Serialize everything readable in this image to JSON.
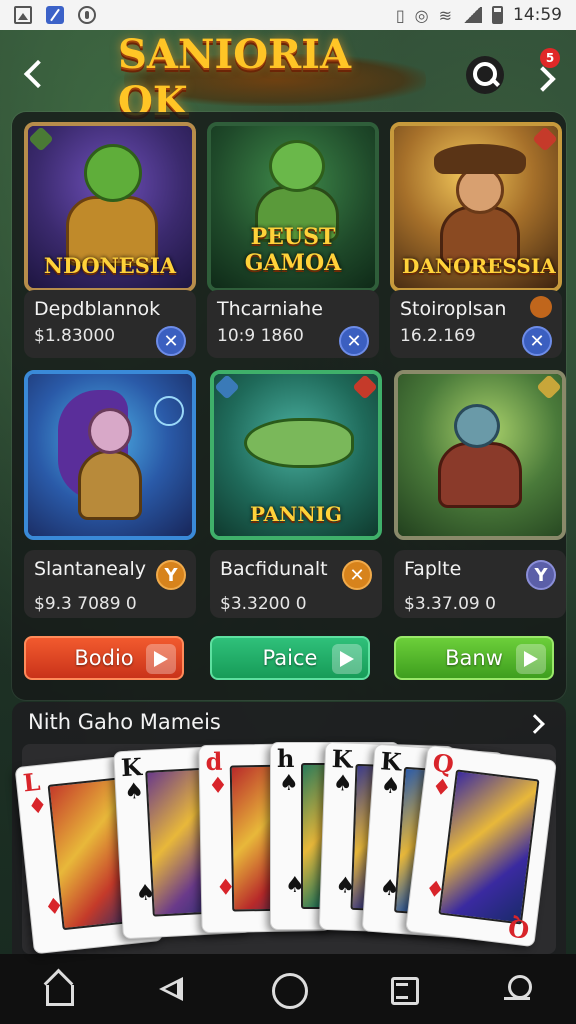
{
  "status_bar": {
    "time": "14:59",
    "icons": [
      "image-icon",
      "app-icon",
      "sync-icon",
      "vibrate-icon",
      "hotspot-icon",
      "wifi-icon",
      "signal-icon",
      "battery-icon"
    ]
  },
  "header": {
    "logo_text": "SANIORIA OK",
    "notification_count": "5"
  },
  "games": [
    {
      "banner": "NDONESIA",
      "title": "Depdblannok",
      "value": "$1.83000",
      "action_icon": "✕"
    },
    {
      "banner": "PEUST GAMOA",
      "title": "Thcarniahe",
      "value": "10:9 1860",
      "action_icon": "✕"
    },
    {
      "banner": "DANORESSIA",
      "title": "Stoiroplsan",
      "value": "16.2.169",
      "action_icon": "✕"
    },
    {
      "banner": "",
      "title": "Slantanealy",
      "value": "$9.3 7089 0",
      "action_icon": "Y",
      "button": "Bodio"
    },
    {
      "banner": "PANNIG",
      "title": "Bacfidunalt",
      "value": "$3.3200 0",
      "action_icon": "✕",
      "button": "Paice"
    },
    {
      "banner": "",
      "title": "Faplte",
      "value": "$3.37.09 0",
      "action_icon": "Y",
      "button": "Banw"
    }
  ],
  "section": {
    "title": "Nith Gaho Mameis"
  },
  "cards": [
    {
      "rank": "L",
      "suit": "♦",
      "color": "red"
    },
    {
      "rank": "K",
      "suit": "♠",
      "color": "black"
    },
    {
      "rank": "d",
      "suit": "♦",
      "color": "red"
    },
    {
      "rank": "h",
      "suit": "♠",
      "color": "black"
    },
    {
      "rank": "K",
      "suit": "♠",
      "color": "black"
    },
    {
      "rank": "K",
      "suit": "♠",
      "color": "black"
    },
    {
      "rank": "Q",
      "suit": "♦",
      "color": "red"
    }
  ],
  "colors": {
    "accent_gold": "#ffc526",
    "panel_bg": "#161a18",
    "button_red": "#e0482a",
    "button_green": "#1fae66",
    "button_lime": "#56b82c"
  }
}
